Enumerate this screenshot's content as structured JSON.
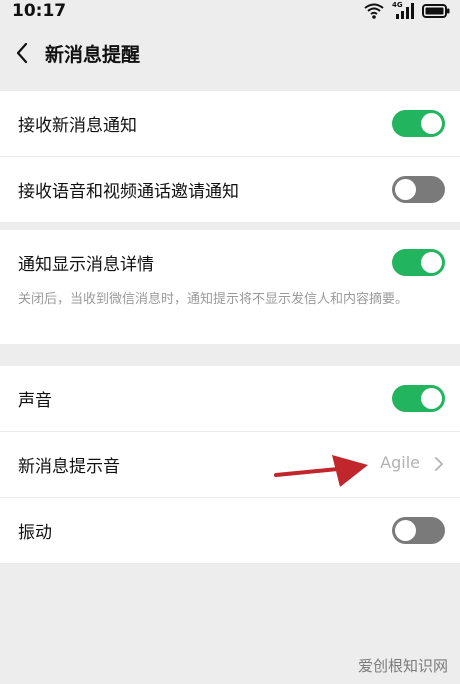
{
  "status": {
    "time": "10:17",
    "network": "4G"
  },
  "header": {
    "title": "新消息提醒"
  },
  "groups": [
    {
      "rows": [
        {
          "label": "接收新消息通知",
          "toggle": true
        },
        {
          "label": "接收语音和视频通话邀请通知",
          "toggle": false
        }
      ]
    },
    {
      "rows": [
        {
          "label": "通知显示消息详情",
          "toggle": true,
          "description": "关闭后，当收到微信消息时，通知提示将不显示发信人和内容摘要。"
        }
      ]
    },
    {
      "rows": [
        {
          "label": "声音",
          "toggle": true
        },
        {
          "label": "新消息提示音",
          "value": "Agile"
        },
        {
          "label": "振动",
          "toggle": false
        }
      ]
    }
  ],
  "watermark": "爱创根知识网",
  "colors": {
    "toggle_on": "#22b45e",
    "toggle_off": "#7a7a7a",
    "annotation_arrow": "#c0262b"
  }
}
